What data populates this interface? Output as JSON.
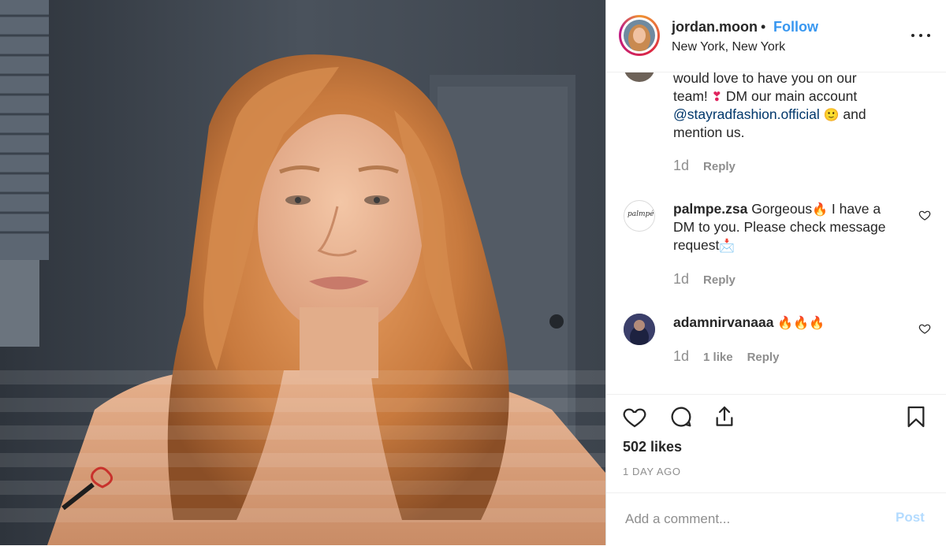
{
  "header": {
    "username": "jordan.moon",
    "separator": "•",
    "follow_label": "Follow",
    "location": "New York, New York",
    "more_icon": "more-horizontal-icon"
  },
  "comments": [
    {
      "avatar": "partial-avatar",
      "text_lines": [
        "would love to have you on our",
        "team! ",
        " DM our main account"
      ],
      "mention": "@stayradfashion.official",
      "after_mention": " and",
      "last_line": "mention us.",
      "age": "1d",
      "reply_label": "Reply",
      "emoji_1": "❣",
      "emoji_2": "🙂"
    },
    {
      "username": "palmpe.zsa",
      "avatar_text": "palmpé",
      "line1": " Gorgeous",
      "line1_after": " I have a",
      "line2": "DM to you. Please check message",
      "line3": "request",
      "emoji_fire": "🔥",
      "emoji_mail": "📩",
      "age": "1d",
      "reply_label": "Reply"
    },
    {
      "username": "adamnirvanaaa",
      "emojis": "🔥🔥🔥",
      "age": "1d",
      "likes_label": "1 like",
      "reply_label": "Reply"
    }
  ],
  "actions": {
    "like_icon": "heart-icon",
    "comment_icon": "comment-icon",
    "share_icon": "share-icon",
    "save_icon": "bookmark-icon",
    "likes": "502 likes",
    "time_ago": "1 DAY AGO"
  },
  "add_comment": {
    "placeholder": "Add a comment...",
    "post_label": "Post"
  },
  "colors": {
    "accent": "#3897f0",
    "mention": "#00376b",
    "muted": "#8e8e8e",
    "post_disabled": "#b3dbff"
  }
}
